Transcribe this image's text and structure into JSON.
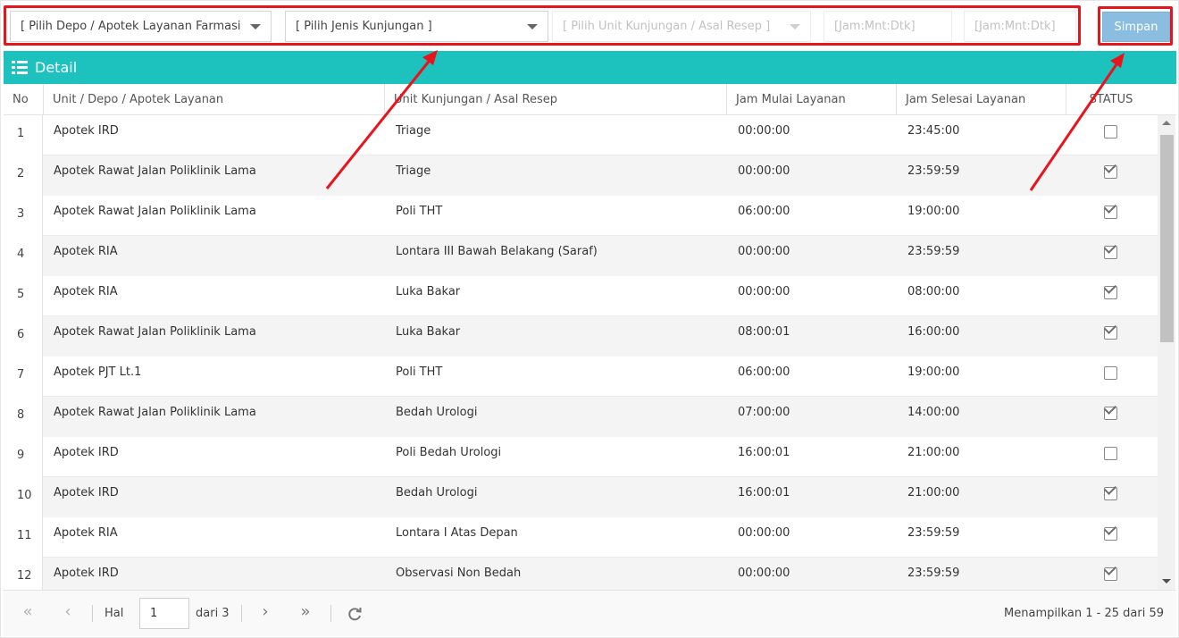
{
  "toolbar": {
    "depo_select": "[ Pilih Depo / Apotek Layanan Farmasi ]",
    "jenis_select": "[ Pilih Jenis Kunjungan ]",
    "unit_select": "[ Pilih Unit Kunjungan / Asal Resep ]",
    "jam_mulai_placeholder": "[Jam:Mnt:Dtk]",
    "jam_selesai_placeholder": "[Jam:Mnt:Dtk]",
    "save_label": "Simpan"
  },
  "panel": {
    "title": "Detail",
    "icon": "list-icon"
  },
  "table": {
    "headers": [
      "No",
      "Unit / Depo / Apotek Layanan",
      "Unit Kunjungan / Asal Resep",
      "Jam Mulai Layanan",
      "Jam Selesai Layanan",
      "STATUS"
    ],
    "rows": [
      {
        "no": "1",
        "unit": "Apotek IRD",
        "kunjungan": "Triage",
        "mulai": "00:00:00",
        "selesai": "23:45:00",
        "status": false
      },
      {
        "no": "2",
        "unit": "Apotek Rawat Jalan Poliklinik Lama",
        "kunjungan": "Triage",
        "mulai": "00:00:00",
        "selesai": "23:59:59",
        "status": true
      },
      {
        "no": "3",
        "unit": "Apotek Rawat Jalan Poliklinik Lama",
        "kunjungan": "Poli THT",
        "mulai": "06:00:00",
        "selesai": "19:00:00",
        "status": true
      },
      {
        "no": "4",
        "unit": "Apotek RIA",
        "kunjungan": "Lontara III Bawah Belakang (Saraf)",
        "mulai": "00:00:00",
        "selesai": "23:59:59",
        "status": true
      },
      {
        "no": "5",
        "unit": "Apotek RIA",
        "kunjungan": "Luka Bakar",
        "mulai": "00:00:00",
        "selesai": "08:00:00",
        "status": true
      },
      {
        "no": "6",
        "unit": "Apotek Rawat Jalan Poliklinik Lama",
        "kunjungan": "Luka Bakar",
        "mulai": "08:00:01",
        "selesai": "16:00:00",
        "status": true
      },
      {
        "no": "7",
        "unit": "Apotek PJT Lt.1",
        "kunjungan": "Poli THT",
        "mulai": "06:00:00",
        "selesai": "19:00:00",
        "status": false
      },
      {
        "no": "8",
        "unit": "Apotek Rawat Jalan Poliklinik Lama",
        "kunjungan": "Bedah Urologi",
        "mulai": "07:00:00",
        "selesai": "14:00:00",
        "status": true
      },
      {
        "no": "9",
        "unit": "Apotek IRD",
        "kunjungan": "Poli Bedah Urologi",
        "mulai": "16:00:01",
        "selesai": "21:00:00",
        "status": false
      },
      {
        "no": "10",
        "unit": "Apotek IRD",
        "kunjungan": "Bedah Urologi",
        "mulai": "16:00:01",
        "selesai": "21:00:00",
        "status": true
      },
      {
        "no": "11",
        "unit": "Apotek RIA",
        "kunjungan": "Lontara I Atas Depan",
        "mulai": "00:00:00",
        "selesai": "23:59:59",
        "status": true
      },
      {
        "no": "12",
        "unit": "Apotek IRD",
        "kunjungan": "Observasi Non Bedah",
        "mulai": "00:00:00",
        "selesai": "23:59:59",
        "status": true
      }
    ]
  },
  "pager": {
    "hal_label": "Hal",
    "page_value": "1",
    "of_label": "dari 3",
    "summary": "Menampilkan 1 - 25 dari 59"
  },
  "colors": {
    "header_teal": "#1dc1be",
    "button_blue": "#8bbde0",
    "annotation_red": "#e8141c"
  }
}
